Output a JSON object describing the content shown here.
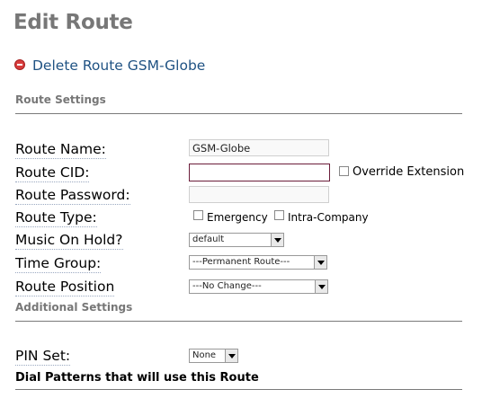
{
  "page": {
    "title": "Edit Route"
  },
  "delete_link": "Delete Route GSM-Globe",
  "route_settings": {
    "heading": "Route Settings",
    "route_name": {
      "label": "Route Name:",
      "value": "GSM-Globe"
    },
    "route_cid": {
      "label": "Route CID:",
      "value": "",
      "override_label": "Override Extension",
      "override_checked": false
    },
    "route_password": {
      "label": "Route Password:",
      "value": ""
    },
    "route_type": {
      "label": "Route Type:",
      "emergency_label": "Emergency",
      "emergency_checked": false,
      "intra_label": "Intra-Company",
      "intra_checked": false
    },
    "music_on_hold": {
      "label": "Music On Hold?",
      "selected": "default"
    },
    "time_group": {
      "label": "Time Group:",
      "selected": "---Permanent Route---"
    },
    "route_position": {
      "label": "Route Position",
      "selected": "---No Change---"
    }
  },
  "additional_settings": {
    "heading": "Additional Settings",
    "pin_set": {
      "label": "PIN Set:",
      "selected": "None"
    }
  },
  "dial_patterns": {
    "heading": "Dial Patterns that will use this Route"
  }
}
